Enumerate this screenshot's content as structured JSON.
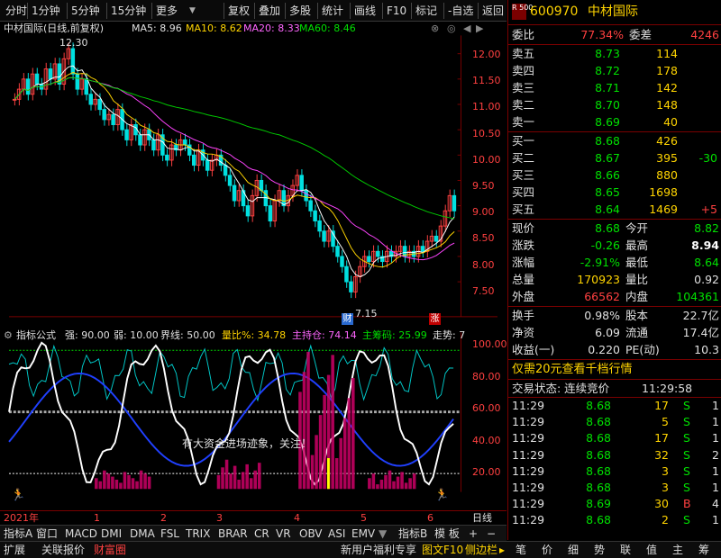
{
  "toolbar": {
    "items": [
      "分时",
      "1分钟",
      "5分钟",
      "15分钟",
      "更多",
      "复权",
      "叠加",
      "多股",
      "统计",
      "画线",
      "F10",
      "标记",
      "-自选",
      "返回"
    ]
  },
  "chart_head": {
    "title": "中材国际(日线,前复权)",
    "ma5": "MA5: 8.96",
    "ma10": "MA10: 8.62",
    "ma20": "MA20: 8.33",
    "ma60": "MA60: 8.46"
  },
  "price_axis": [
    "12.00",
    "11.50",
    "11.00",
    "10.50",
    "10.00",
    "9.50",
    "9.00",
    "8.50",
    "8.00",
    "7.50"
  ],
  "annotations": {
    "high": "12.30",
    "low": "7.15",
    "cai": "财",
    "zhang": "涨"
  },
  "indicator_head": {
    "name": "指标公式",
    "qiang": "强: 90.00",
    "ruo": "弱: 10.00",
    "jie": "界线: 50.00",
    "lb": "量比%: 34.78",
    "zcc": "主持仓: 74.14",
    "zcm": "主筹码: 25.99",
    "zs": "走势: 7"
  },
  "ind_axis": [
    "100.00",
    "80.00",
    "60.00",
    "40.00",
    "20.00"
  ],
  "ind_text": "有大资金进场迹象，关注！",
  "time_axis": [
    "2021年",
    "1",
    "2",
    "3",
    "4",
    "5",
    "6",
    "日线"
  ],
  "bottom_tabs": [
    "指标A",
    "窗口",
    "MACD",
    "DMI",
    "DMA",
    "FSL",
    "TRIX",
    "BRAR",
    "CR",
    "VR",
    "OBV",
    "ASI",
    "EMV",
    "指标B",
    "模 板"
  ],
  "bottom_bar": [
    "扩展",
    "关联报价",
    "财富圈",
    "新用户福利专享",
    "图文F10",
    "侧边栏"
  ],
  "bottom_right": [
    "笔",
    "价",
    "细",
    "势",
    "联",
    "值",
    "主",
    "筹"
  ],
  "stock": {
    "code": "600970",
    "name": "中材国际",
    "badge": "R 500"
  },
  "weibi": {
    "label": "委比",
    "value": "77.34%",
    "label2": "委差",
    "value2": "4246"
  },
  "sell": [
    {
      "l": "卖五",
      "p": "8.73",
      "v": "114"
    },
    {
      "l": "卖四",
      "p": "8.72",
      "v": "178"
    },
    {
      "l": "卖三",
      "p": "8.71",
      "v": "142"
    },
    {
      "l": "卖二",
      "p": "8.70",
      "v": "148"
    },
    {
      "l": "卖一",
      "p": "8.69",
      "v": "40"
    }
  ],
  "buy": [
    {
      "l": "买一",
      "p": "8.68",
      "v": "426",
      "d": ""
    },
    {
      "l": "买二",
      "p": "8.67",
      "v": "395",
      "d": "-30"
    },
    {
      "l": "买三",
      "p": "8.66",
      "v": "880",
      "d": ""
    },
    {
      "l": "买四",
      "p": "8.65",
      "v": "1698",
      "d": ""
    },
    {
      "l": "买五",
      "p": "8.64",
      "v": "1469",
      "d": "+5"
    }
  ],
  "quote": [
    {
      "l": "现价",
      "v": "8.68",
      "l2": "今开",
      "v2": "8.82"
    },
    {
      "l": "涨跌",
      "v": "-0.26",
      "l2": "最高",
      "v2": "8.94"
    },
    {
      "l": "涨幅",
      "v": "-2.91%",
      "l2": "最低",
      "v2": "8.64"
    },
    {
      "l": "总量",
      "v": "170923",
      "l2": "量比",
      "v2": "0.92"
    },
    {
      "l": "外盘",
      "v": "66562",
      "l2": "内盘",
      "v2": "104361"
    }
  ],
  "fin": [
    {
      "l": "换手",
      "v": "0.98%",
      "l2": "股本",
      "v2": "22.7亿"
    },
    {
      "l": "净资",
      "v": "6.09",
      "l2": "流通",
      "v2": "17.4亿"
    },
    {
      "l": "收益(一)",
      "v": "0.220",
      "l2": "PE(动)",
      "v2": "10.3"
    }
  ],
  "promo": "仅需20元查看千档行情",
  "trade_status": {
    "label": "交易状态: 连续竞价",
    "time": "11:29:58"
  },
  "ticks": [
    {
      "t": "11:29",
      "p": "8.68",
      "v": "17",
      "s": "S",
      "n": "1"
    },
    {
      "t": "11:29",
      "p": "8.68",
      "v": "5",
      "s": "S",
      "n": "1"
    },
    {
      "t": "11:29",
      "p": "8.68",
      "v": "17",
      "s": "S",
      "n": "1"
    },
    {
      "t": "11:29",
      "p": "8.68",
      "v": "32",
      "s": "S",
      "n": "2"
    },
    {
      "t": "11:29",
      "p": "8.68",
      "v": "3",
      "s": "S",
      "n": "1"
    },
    {
      "t": "11:29",
      "p": "8.68",
      "v": "3",
      "s": "S",
      "n": "1"
    },
    {
      "t": "11:29",
      "p": "8.69",
      "v": "30",
      "s": "B",
      "n": "4"
    },
    {
      "t": "11:29",
      "p": "8.68",
      "v": "2",
      "s": "S",
      "n": "1"
    }
  ]
}
